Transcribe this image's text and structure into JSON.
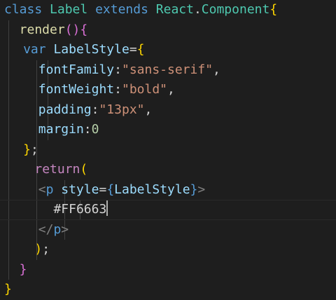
{
  "colors": {
    "background": "#1e1e1e",
    "keyword_storage": "#569cd6",
    "class_name": "#4ec9b0",
    "function": "#dcdcaa",
    "variable": "#9cdcfe",
    "string": "#ce9178",
    "number": "#b5cea8",
    "control_keyword": "#c586c0",
    "tag_bracket": "#808080",
    "tag_name": "#569cd6",
    "brace_gold": "#ffd700",
    "brace_purple": "#da70d6",
    "punctuation": "#d4d4d4",
    "indent_guide": "#404040",
    "cursor": "#aeafad"
  },
  "editor": {
    "lines": [
      {
        "indent": 0,
        "tokens": [
          {
            "text": "class ",
            "c": "keyword_storage"
          },
          {
            "text": "Label ",
            "c": "class_name"
          },
          {
            "text": "extends ",
            "c": "keyword_storage"
          },
          {
            "text": "React",
            "c": "class_name"
          },
          {
            "text": ".",
            "c": "punctuation"
          },
          {
            "text": "Component",
            "c": "class_name"
          },
          {
            "text": "{",
            "c": "brace_gold"
          }
        ]
      },
      {
        "indent": 2,
        "tokens": [
          {
            "text": "render",
            "c": "function"
          },
          {
            "text": "()",
            "c": "brace_purple"
          },
          {
            "text": "{",
            "c": "brace_purple"
          }
        ]
      },
      {
        "indent": 2.5,
        "tokens": [
          {
            "text": "var ",
            "c": "keyword_storage"
          },
          {
            "text": "LabelStyle",
            "c": "variable"
          },
          {
            "text": "=",
            "c": "punctuation"
          },
          {
            "text": "{",
            "c": "brace_gold"
          }
        ]
      },
      {
        "indent": 4.5,
        "tokens": [
          {
            "text": "fontFamily",
            "c": "variable"
          },
          {
            "text": ":",
            "c": "punctuation"
          },
          {
            "text": "\"sans-serif\"",
            "c": "string"
          },
          {
            "text": ",",
            "c": "punctuation"
          }
        ]
      },
      {
        "indent": 4.5,
        "tokens": [
          {
            "text": "fontWeight",
            "c": "variable"
          },
          {
            "text": ":",
            "c": "punctuation"
          },
          {
            "text": "\"bold\"",
            "c": "string"
          },
          {
            "text": ",",
            "c": "punctuation"
          }
        ]
      },
      {
        "indent": 4.5,
        "tokens": [
          {
            "text": "padding",
            "c": "variable"
          },
          {
            "text": ":",
            "c": "punctuation"
          },
          {
            "text": "\"13px\"",
            "c": "string"
          },
          {
            "text": ",",
            "c": "punctuation"
          }
        ]
      },
      {
        "indent": 4.5,
        "tokens": [
          {
            "text": "margin",
            "c": "variable"
          },
          {
            "text": ":",
            "c": "punctuation"
          },
          {
            "text": "0",
            "c": "number"
          }
        ]
      },
      {
        "indent": 2.5,
        "tokens": [
          {
            "text": "}",
            "c": "brace_gold"
          },
          {
            "text": ";",
            "c": "punctuation"
          }
        ]
      },
      {
        "indent": 4,
        "tokens": [
          {
            "text": "return",
            "c": "control_keyword"
          },
          {
            "text": "(",
            "c": "brace_gold"
          }
        ]
      },
      {
        "indent": 4.5,
        "tokens": [
          {
            "text": "<",
            "c": "tag_bracket"
          },
          {
            "text": "p ",
            "c": "tag_name"
          },
          {
            "text": "style",
            "c": "variable"
          },
          {
            "text": "=",
            "c": "punctuation"
          },
          {
            "text": "{",
            "c": "keyword_storage"
          },
          {
            "text": "LabelStyle",
            "c": "variable"
          },
          {
            "text": "}",
            "c": "keyword_storage"
          },
          {
            "text": ">",
            "c": "tag_bracket"
          }
        ]
      },
      {
        "indent": 6.5,
        "current": true,
        "cursor": true,
        "tokens": [
          {
            "text": "#FF6663",
            "c": "punctuation"
          }
        ]
      },
      {
        "indent": 4.5,
        "tokens": [
          {
            "text": "</",
            "c": "tag_bracket"
          },
          {
            "text": "p",
            "c": "tag_name"
          },
          {
            "text": ">",
            "c": "tag_bracket"
          }
        ]
      },
      {
        "indent": 4,
        "tokens": [
          {
            "text": ")",
            "c": "brace_gold"
          },
          {
            "text": ";",
            "c": "punctuation"
          }
        ]
      },
      {
        "indent": 2,
        "tokens": [
          {
            "text": "}",
            "c": "brace_purple"
          }
        ]
      },
      {
        "indent": 0,
        "tokens": [
          {
            "text": "}",
            "c": "brace_gold"
          }
        ]
      }
    ]
  }
}
